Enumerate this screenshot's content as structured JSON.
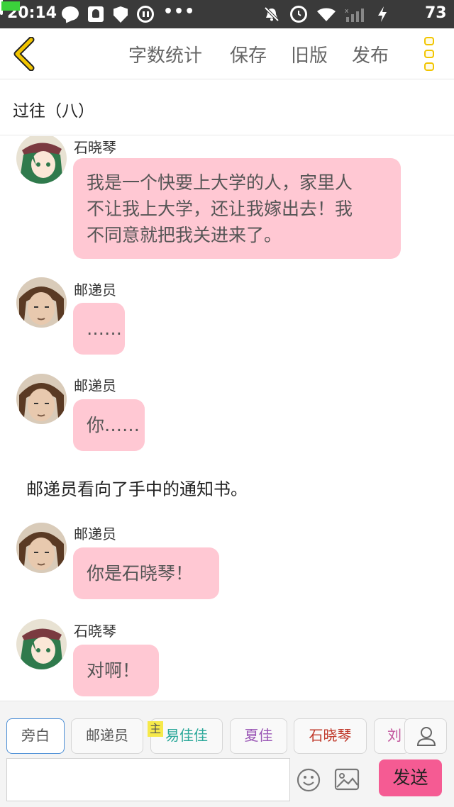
{
  "status_bar": {
    "time": "20:14",
    "battery_level": "73",
    "icons": [
      "message-icon",
      "ghost-icon",
      "shield-icon",
      "pause-icon",
      "more-dots-icon",
      "mute-bell-icon",
      "alarm-icon",
      "wifi-icon",
      "signal-icon",
      "charging-icon",
      "battery-icon"
    ],
    "more_dots": "•••"
  },
  "toolbar": {
    "back_icon": "chevron-left-icon",
    "word_count": "字数统计",
    "save": "保存",
    "old_version": "旧版",
    "publish": "发布",
    "menu_icon": "vertical-dots-icon"
  },
  "story": {
    "title": "过往（八）"
  },
  "messages": [
    {
      "speaker": "石晓琴",
      "text": "我是一个快要上大学的人，家里人不让我上大学，还让我嫁出去！我不同意就把我关进来了。",
      "lines": [
        "我是一个快要上大学的人，家里人",
        "不让我上大学，还让我嫁出去！我",
        "不同意就把我关进来了。"
      ],
      "avatar": "girl-avatar"
    },
    {
      "speaker": "邮递员",
      "text": "……",
      "avatar": "postman-avatar"
    },
    {
      "speaker": "邮递员",
      "text": "你……",
      "avatar": "postman-avatar"
    },
    {
      "narration": "邮递员看向了手中的通知书。"
    },
    {
      "speaker": "邮递员",
      "text": "你是石晓琴！",
      "avatar": "postman-avatar"
    },
    {
      "speaker": "石晓琴",
      "text": "对啊！",
      "avatar": "girl-avatar"
    }
  ],
  "characters": [
    {
      "name": "旁白",
      "color": "#555555",
      "active": true
    },
    {
      "name": "邮递员",
      "color": "#555555"
    },
    {
      "name": "易佳佳",
      "color": "#2ba89a",
      "tag": "主"
    },
    {
      "name": "夏佳",
      "color": "#9b59b6"
    },
    {
      "name": "石晓琴",
      "color": "#c0392b"
    },
    {
      "name": "刘",
      "color": "#c2549c"
    }
  ],
  "composer": {
    "input_value": "",
    "emoji_icon": "emoji-icon",
    "image_icon": "image-icon",
    "send": "发送"
  },
  "colors": {
    "bubble": "#ffc8d3",
    "send_button": "#f55b93",
    "accent_yellow": "#f2c500",
    "active_chip": "#4d8fd6"
  }
}
